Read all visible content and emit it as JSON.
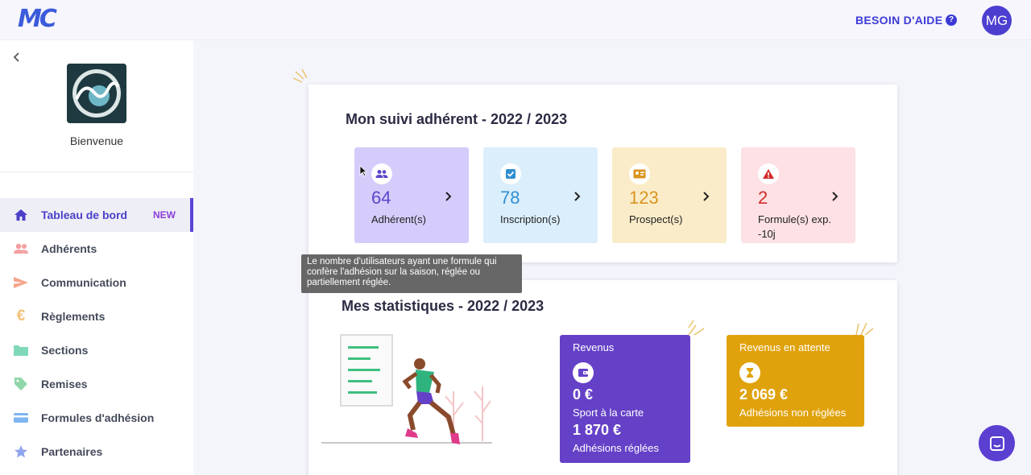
{
  "header": {
    "logo_text": "MC",
    "help_label": "BESOIN D'AIDE",
    "help_icon": "?",
    "avatar_initials": "MG"
  },
  "sidebar": {
    "welcome": "Bienvenue",
    "items": [
      {
        "label": "Tableau de bord",
        "badge": "NEW",
        "icon": "home-icon",
        "color": "#4a3fc8"
      },
      {
        "label": "Adhérents",
        "icon": "users-icon",
        "color": "#f4a0a0"
      },
      {
        "label": "Communication",
        "icon": "send-icon",
        "color": "#f4a48a"
      },
      {
        "label": "Règlements",
        "icon": "euro-icon",
        "color": "#f2c27a"
      },
      {
        "label": "Sections",
        "icon": "folder-icon",
        "color": "#7fd9b8"
      },
      {
        "label": "Remises",
        "icon": "tag-icon",
        "color": "#8fd7a8"
      },
      {
        "label": "Formules d'adhésion",
        "icon": "card-icon",
        "color": "#7fb5f0"
      },
      {
        "label": "Partenaires",
        "icon": "star-icon",
        "color": "#8fa5ee"
      }
    ]
  },
  "suivi": {
    "title": "Mon suivi adhérent - 2022 / 2023",
    "tiles": [
      {
        "value": "64",
        "label": "Adhérent(s)",
        "bg": "#d5ccfb",
        "color": "#5b45c9",
        "icon": "users-icon"
      },
      {
        "value": "78",
        "label": "Inscription(s)",
        "bg": "#dbeefc",
        "color": "#2f8fd0",
        "icon": "check-badge-icon"
      },
      {
        "value": "123",
        "label": "Prospect(s)",
        "bg": "#fbecc9",
        "color": "#d99520",
        "icon": "id-card-icon"
      },
      {
        "value": "2",
        "label": "Formule(s) exp. -10j",
        "bg": "#fde1e4",
        "color": "#d22b2b",
        "icon": "warning-icon"
      }
    ]
  },
  "tooltip": {
    "text": "Le nombre d'utilisateurs ayant une formule qui confère l'adhésion sur la saison, réglée ou partiellement réglée."
  },
  "stats": {
    "title": "Mes statistiques - 2022 / 2023",
    "revenus": {
      "title": "Revenus",
      "amount1": "0 €",
      "label1": "Sport à la carte",
      "amount2": "1 870 €",
      "label2": "Adhésions réglées"
    },
    "pending": {
      "title": "Revenus en attente",
      "amount": "2 069 €",
      "label": "Adhésions non réglées"
    }
  }
}
